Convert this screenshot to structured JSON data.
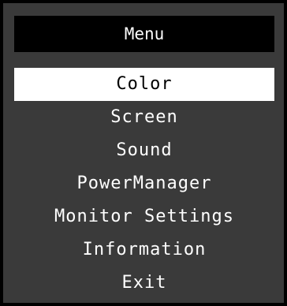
{
  "menu": {
    "title": "Menu",
    "items": [
      {
        "label": "Color",
        "selected": true
      },
      {
        "label": "Screen",
        "selected": false
      },
      {
        "label": "Sound",
        "selected": false
      },
      {
        "label": "PowerManager",
        "selected": false
      },
      {
        "label": "Monitor Settings",
        "selected": false
      },
      {
        "label": "Information",
        "selected": false
      },
      {
        "label": "Exit",
        "selected": false
      }
    ]
  },
  "colors": {
    "panel_background": "#3a3a3a",
    "title_background": "#000000",
    "selection_background": "#ffffff",
    "text": "#ffffff",
    "selected_text": "#000000"
  }
}
